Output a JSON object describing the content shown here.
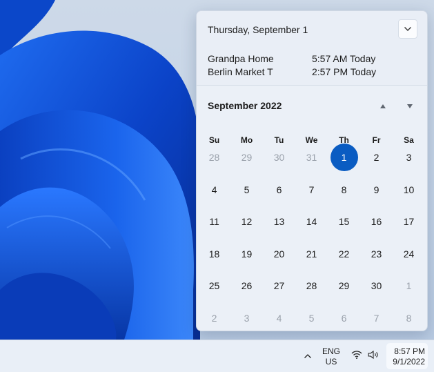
{
  "flyout": {
    "date_title": "Thursday, September 1",
    "events": [
      {
        "name": "Grandpa Home",
        "time": "5:57 AM Today"
      },
      {
        "name": "Berlin Market T",
        "time": "2:57 PM Today"
      }
    ],
    "calendar": {
      "month_title": "September 2022",
      "weekdays": [
        "Su",
        "Mo",
        "Tu",
        "We",
        "Th",
        "Fr",
        "Sa"
      ],
      "weeks": [
        [
          {
            "d": "28",
            "m": true
          },
          {
            "d": "29",
            "m": true
          },
          {
            "d": "30",
            "m": true
          },
          {
            "d": "31",
            "m": true
          },
          {
            "d": "1",
            "today": true
          },
          {
            "d": "2"
          },
          {
            "d": "3"
          }
        ],
        [
          {
            "d": "4"
          },
          {
            "d": "5"
          },
          {
            "d": "6"
          },
          {
            "d": "7"
          },
          {
            "d": "8"
          },
          {
            "d": "9"
          },
          {
            "d": "10"
          }
        ],
        [
          {
            "d": "11"
          },
          {
            "d": "12"
          },
          {
            "d": "13"
          },
          {
            "d": "14"
          },
          {
            "d": "15"
          },
          {
            "d": "16"
          },
          {
            "d": "17"
          }
        ],
        [
          {
            "d": "18"
          },
          {
            "d": "19"
          },
          {
            "d": "20"
          },
          {
            "d": "21"
          },
          {
            "d": "22"
          },
          {
            "d": "23"
          },
          {
            "d": "24"
          }
        ],
        [
          {
            "d": "25"
          },
          {
            "d": "26"
          },
          {
            "d": "27"
          },
          {
            "d": "28"
          },
          {
            "d": "29"
          },
          {
            "d": "30"
          },
          {
            "d": "1",
            "m": true
          }
        ],
        [
          {
            "d": "2",
            "m": true
          },
          {
            "d": "3",
            "m": true
          },
          {
            "d": "4",
            "m": true
          },
          {
            "d": "5",
            "m": true
          },
          {
            "d": "6",
            "m": true
          },
          {
            "d": "7",
            "m": true
          },
          {
            "d": "8",
            "m": true
          }
        ]
      ]
    }
  },
  "taskbar": {
    "language_line1": "ENG",
    "language_line2": "US",
    "clock_time": "8:57 PM",
    "clock_date": "9/1/2022"
  },
  "icons": {
    "collapse": "chevron-down-icon",
    "prev_month": "triangle-up-icon",
    "next_month": "triangle-down-icon",
    "tray": "chevron-up-icon",
    "wifi": "wifi-icon",
    "volume": "volume-icon"
  },
  "colors": {
    "accent": "#0a5cc2",
    "wallpaper_blue": "#0d4fd6"
  }
}
